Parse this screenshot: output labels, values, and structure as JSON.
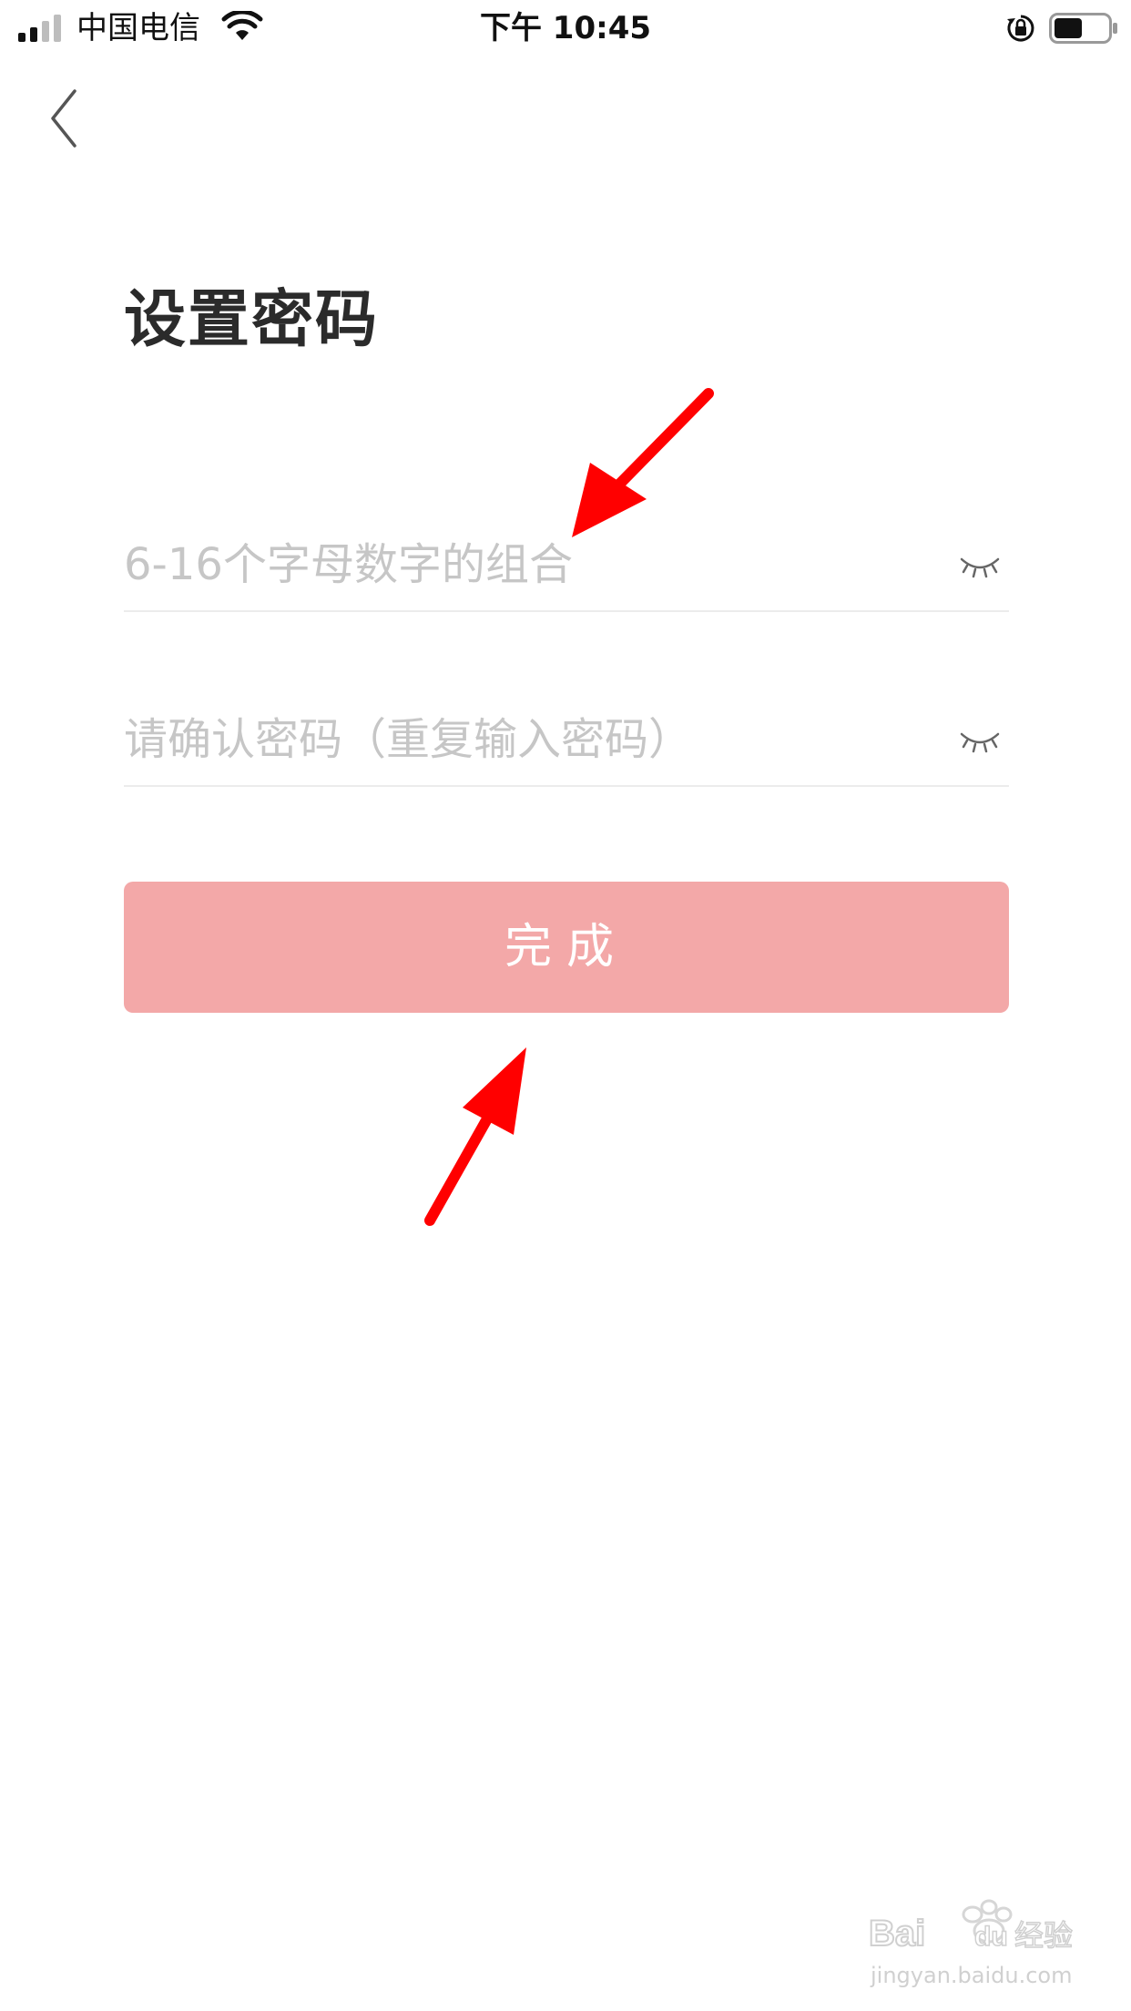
{
  "status_bar": {
    "carrier": "中国电信",
    "time": "下午 10:45",
    "signal_icon": "cellular-signal-icon",
    "wifi_icon": "wifi-icon",
    "rotation_lock_icon": "rotation-lock-icon",
    "battery_icon": "battery-icon"
  },
  "nav": {
    "back_icon": "chevron-left-icon"
  },
  "page": {
    "title": "设置密码"
  },
  "form": {
    "password": {
      "placeholder": "6-16个字母数字的组合",
      "value": "",
      "toggle_icon": "eye-closed-icon"
    },
    "confirm_password": {
      "placeholder": "请确认密码（重复输入密码）",
      "value": "",
      "toggle_icon": "eye-closed-icon"
    },
    "submit_label": "完成"
  },
  "watermark": {
    "logo_text": "Baidu经验",
    "url": "jingyan.baidu.com"
  },
  "colors": {
    "accent_button": "#f3a8a8",
    "annotation_arrow": "#ff0000",
    "placeholder": "#c6c6c6"
  }
}
